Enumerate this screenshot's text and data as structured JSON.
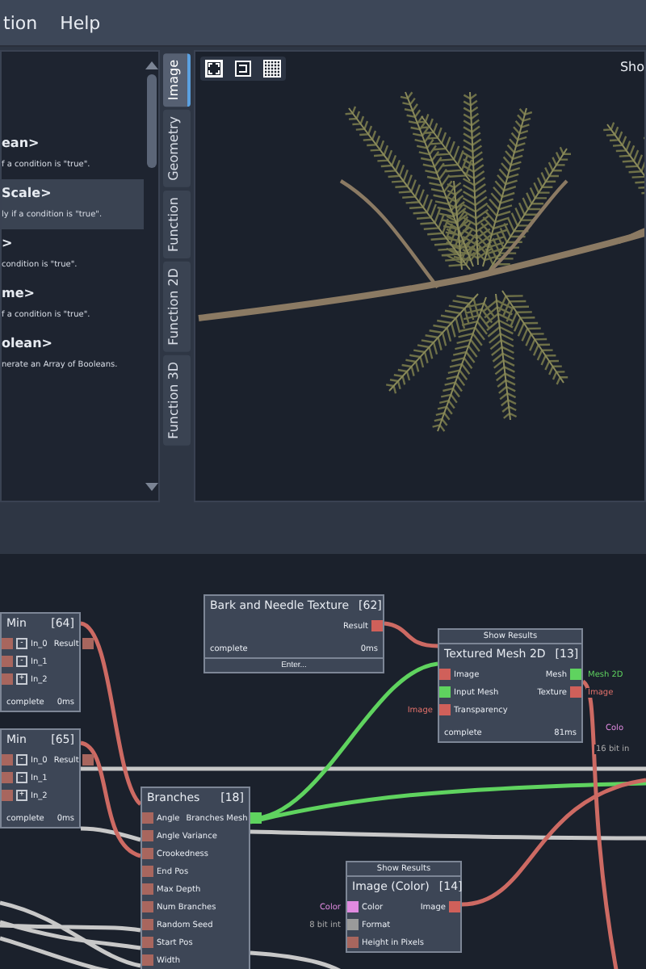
{
  "menu": [
    "tion",
    "Help"
  ],
  "library": {
    "items": [
      {
        "title": "ean>",
        "desc": "f a condition is \"true\".",
        "selected": false
      },
      {
        "title": "Scale>",
        "desc": "ly if a condition is \"true\".",
        "selected": true
      },
      {
        "title": ">",
        "desc": "condition is \"true\".",
        "selected": false
      },
      {
        "title": "me>",
        "desc": "f a condition is \"true\".",
        "selected": false
      },
      {
        "title": "olean>",
        "desc": "nerate an Array of Booleans.",
        "selected": false
      }
    ]
  },
  "tabs": [
    {
      "label": "Image",
      "selected": true
    },
    {
      "label": "Geometry",
      "selected": false
    },
    {
      "label": "Function",
      "selected": false
    },
    {
      "label": "Function 2D",
      "selected": false
    },
    {
      "label": "Function 3D",
      "selected": false
    }
  ],
  "viewer": {
    "show_label": "Sho"
  },
  "nodes": [
    {
      "title": "Min",
      "number": "[64]",
      "inputs": [
        {
          "label": "In_0",
          "kind": "number",
          "control": "-"
        },
        {
          "label": "In_1",
          "kind": "number",
          "control": "-"
        },
        {
          "label": "In_2",
          "kind": "number",
          "control": "+"
        }
      ],
      "outputs": [
        {
          "label": "Result",
          "kind": "number"
        }
      ],
      "status": "complete",
      "time": "0ms"
    },
    {
      "title": "Min",
      "number": "[65]",
      "inputs": [
        {
          "label": "In_0",
          "kind": "number",
          "control": "-"
        },
        {
          "label": "In_1",
          "kind": "number",
          "control": "-"
        },
        {
          "label": "In_2",
          "kind": "number",
          "control": "+"
        }
      ],
      "outputs": [
        {
          "label": "Result",
          "kind": "number"
        }
      ],
      "status": "complete",
      "time": "0ms"
    },
    {
      "title": "Bark and Needle Texture",
      "number": "[62]",
      "outputs": [
        {
          "label": "Result",
          "kind": "image"
        }
      ],
      "status": "complete",
      "time": "0ms",
      "button": "Enter..."
    },
    {
      "title": "Textured Mesh 2D",
      "number": "[13]",
      "banner": "Show Results",
      "inputs": [
        {
          "label": "Image",
          "kind": "image"
        },
        {
          "label": "Input Mesh",
          "kind": "mesh"
        },
        {
          "label": "Transparency",
          "kind": "image",
          "side_label": "Image"
        }
      ],
      "outputs": [
        {
          "label": "Mesh",
          "kind": "mesh",
          "link_label": "Mesh 2D"
        },
        {
          "label": "Texture",
          "kind": "image",
          "link_label": "Image"
        }
      ],
      "status": "complete",
      "time": "81ms"
    },
    {
      "title": "Branches",
      "number": "[18]",
      "inputs": [
        {
          "label": "Angle",
          "kind": "number"
        },
        {
          "label": "Angle Variance",
          "kind": "number"
        },
        {
          "label": "Crookedness",
          "kind": "number"
        },
        {
          "label": "End Pos",
          "kind": "number"
        },
        {
          "label": "Max Depth",
          "kind": "number"
        },
        {
          "label": "Num Branches",
          "kind": "number"
        },
        {
          "label": "Random Seed",
          "kind": "number"
        },
        {
          "label": "Start Pos",
          "kind": "number"
        },
        {
          "label": "Width",
          "kind": "number"
        }
      ],
      "outputs": [
        {
          "label": "Branches Mesh",
          "kind": "mesh"
        }
      ]
    },
    {
      "title": "Image (Color)",
      "number": "[14]",
      "banner": "Show Results",
      "inputs": [
        {
          "label": "Color",
          "kind": "color",
          "side_label": "Color"
        },
        {
          "label": "Format",
          "kind": "enum",
          "side_label": "8 bit int"
        },
        {
          "label": "Height in Pixels",
          "kind": "number"
        }
      ],
      "outputs": [
        {
          "label": "Image",
          "kind": "image"
        }
      ]
    }
  ],
  "edge_labels": [
    {
      "text": "Colo",
      "kind": "color"
    },
    {
      "text": "16 bit in",
      "kind": "enum"
    }
  ]
}
